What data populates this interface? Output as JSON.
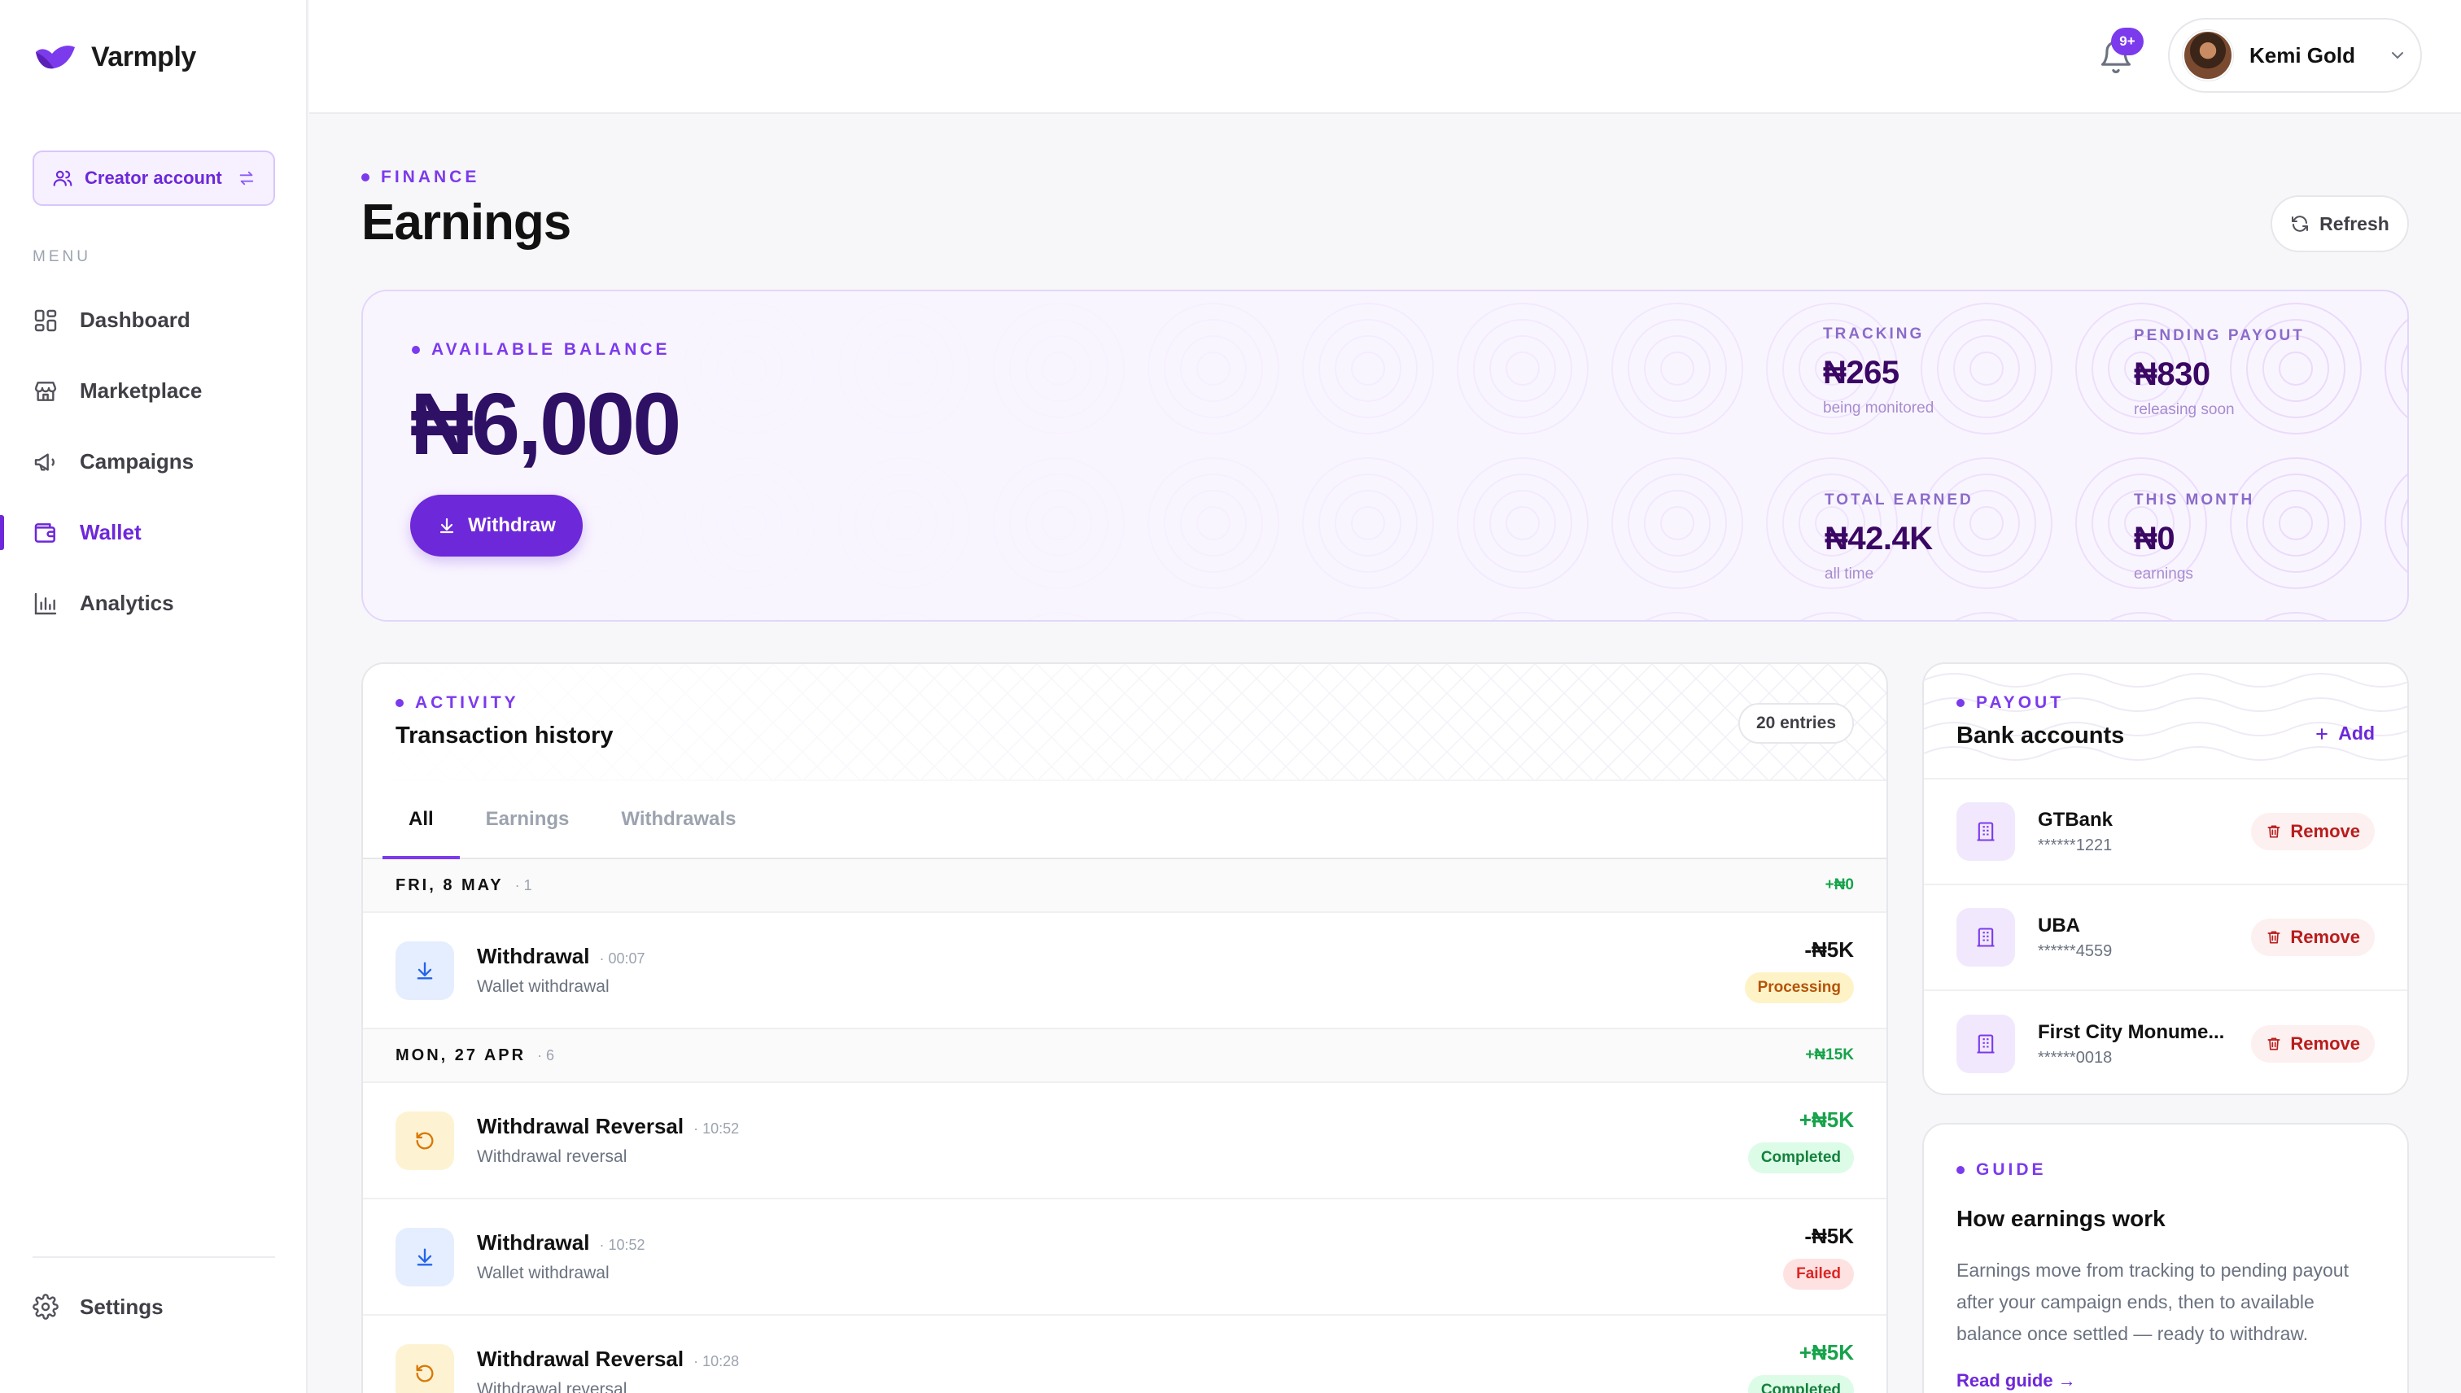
{
  "brand": {
    "name": "Varmply",
    "color": "#7c3aed"
  },
  "sidebar": {
    "account_switch": "Creator account",
    "menu_label": "MENU",
    "items": [
      {
        "label": "Dashboard",
        "icon": "grid-icon"
      },
      {
        "label": "Marketplace",
        "icon": "store-icon"
      },
      {
        "label": "Campaigns",
        "icon": "megaphone-icon"
      },
      {
        "label": "Wallet",
        "icon": "wallet-icon",
        "active": true
      },
      {
        "label": "Analytics",
        "icon": "bar-chart-icon"
      }
    ],
    "settings": "Settings"
  },
  "topbar": {
    "notification_count": "9+",
    "user_name": "Kemi Gold"
  },
  "page": {
    "eyebrow": "FINANCE",
    "title": "Earnings",
    "refresh_label": "Refresh"
  },
  "balance": {
    "eyebrow": "AVAILABLE BALANCE",
    "amount": "₦6,000",
    "withdraw_label": "Withdraw",
    "stats": [
      {
        "label": "TRACKING",
        "value": "₦265",
        "sub": "being monitored"
      },
      {
        "label": "PENDING PAYOUT",
        "value": "₦830",
        "sub": "releasing soon"
      },
      {
        "label": "TOTAL EARNED",
        "value": "₦42.4K",
        "sub": "all time"
      },
      {
        "label": "THIS MONTH",
        "value": "₦0",
        "sub": "earnings"
      }
    ]
  },
  "activity": {
    "eyebrow": "ACTIVITY",
    "title": "Transaction history",
    "entries": "20 entries",
    "tabs": [
      "All",
      "Earnings",
      "Withdrawals"
    ],
    "groups": [
      {
        "date": "FRI, 8 MAY",
        "count": "· 1",
        "total": "+₦0",
        "items": [
          {
            "name": "Withdrawal",
            "time": "· 00:07",
            "desc": "Wallet withdrawal",
            "amount": "-₦5K",
            "status": "Processing",
            "kind": "withdrawal"
          }
        ]
      },
      {
        "date": "MON, 27 APR",
        "count": "· 6",
        "total": "+₦15K",
        "items": [
          {
            "name": "Withdrawal Reversal",
            "time": "· 10:52",
            "desc": "Withdrawal reversal",
            "amount": "+₦5K",
            "status": "Completed",
            "kind": "reversal"
          },
          {
            "name": "Withdrawal",
            "time": "· 10:52",
            "desc": "Wallet withdrawal",
            "amount": "-₦5K",
            "status": "Failed",
            "kind": "withdrawal"
          },
          {
            "name": "Withdrawal Reversal",
            "time": "· 10:28",
            "desc": "Withdrawal reversal",
            "amount": "+₦5K",
            "status": "Completed",
            "kind": "reversal"
          }
        ]
      }
    ]
  },
  "payout": {
    "eyebrow": "PAYOUT",
    "title": "Bank accounts",
    "add_label": "Add",
    "remove_label": "Remove",
    "banks": [
      {
        "name": "GTBank",
        "account": "******1221"
      },
      {
        "name": "UBA",
        "account": "******4559"
      },
      {
        "name": "First City Monume...",
        "account": "******0018"
      }
    ]
  },
  "guide": {
    "eyebrow": "GUIDE",
    "title": "How earnings work",
    "body": "Earnings move from tracking to pending payout after your campaign ends, then to available balance once settled — ready to withdraw.",
    "link": "Read guide →"
  }
}
